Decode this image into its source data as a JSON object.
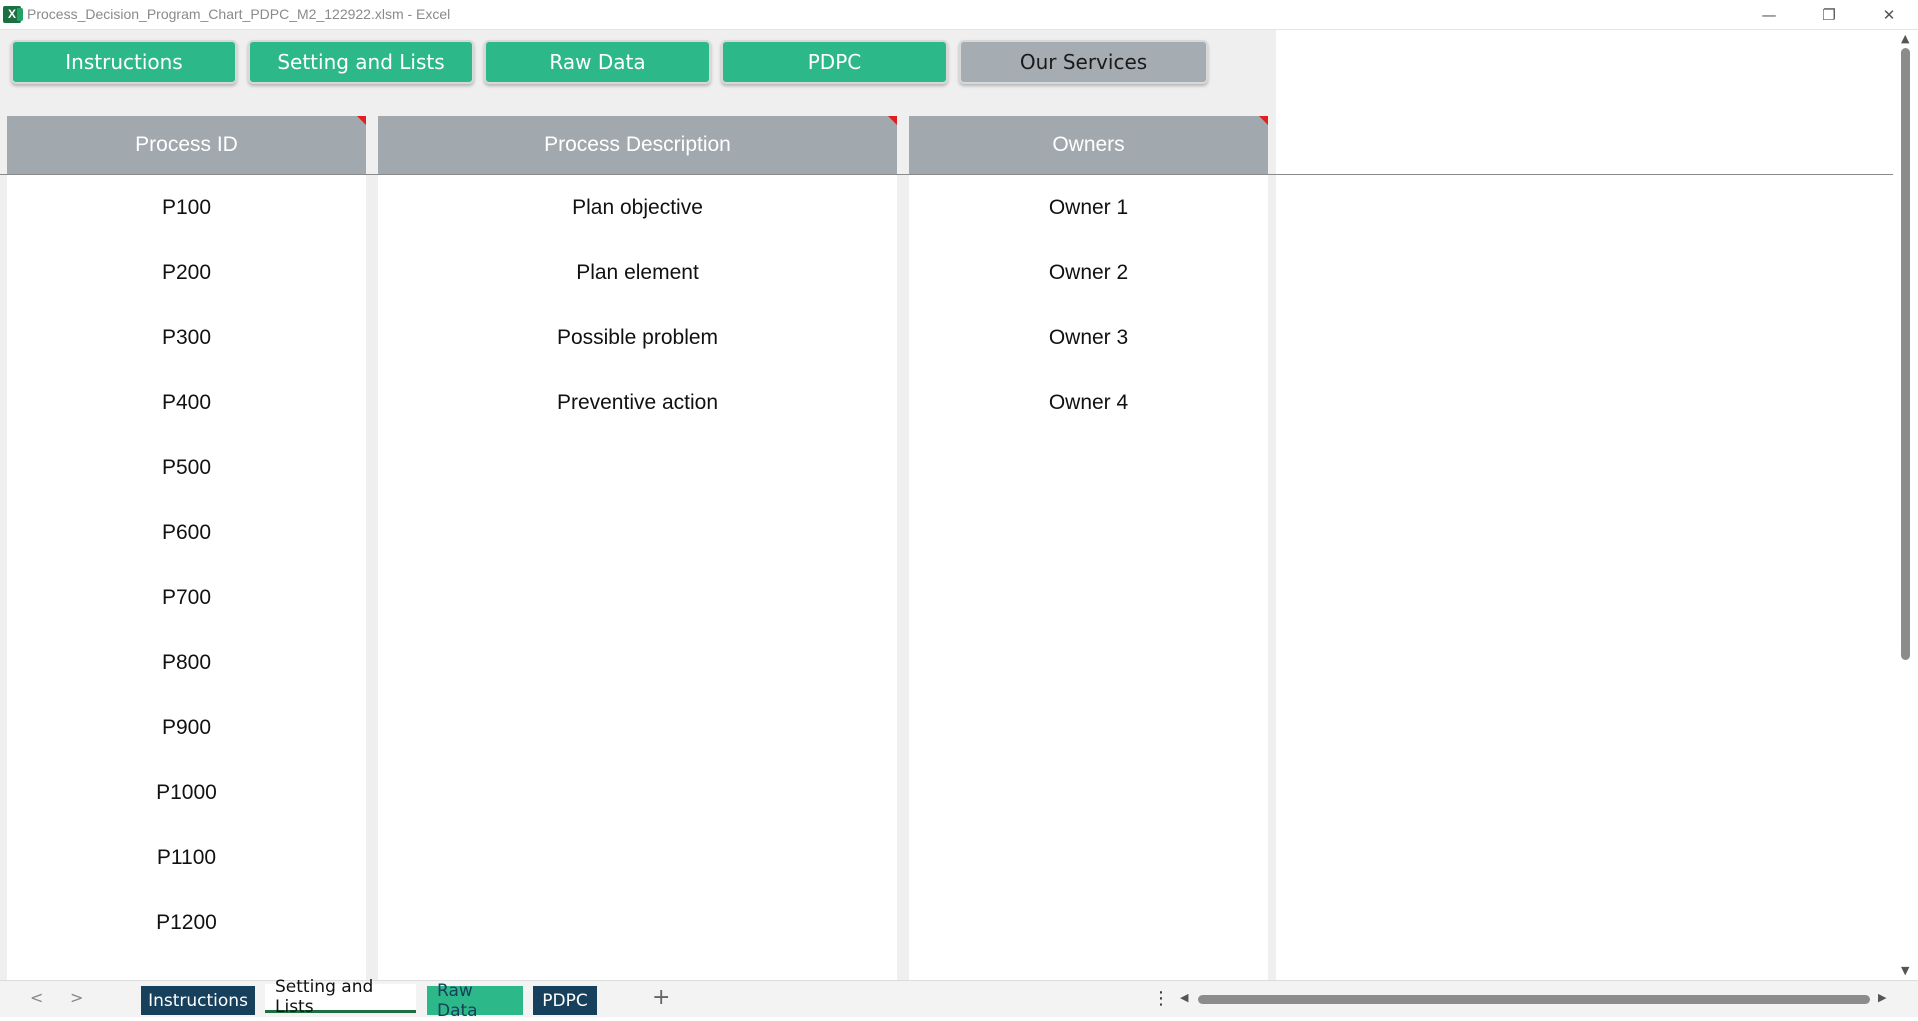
{
  "window": {
    "title": "Process_Decision_Program_Chart_PDPC_M2_122922.xlsm - Excel",
    "app_icon_letter": "X",
    "controls": {
      "minimize": "—",
      "restore": "❐",
      "close": "✕"
    }
  },
  "nav_buttons": [
    {
      "label": "Instructions"
    },
    {
      "label": "Setting and Lists"
    },
    {
      "label": "Raw Data"
    },
    {
      "label": "PDPC"
    },
    {
      "label": "Our Services"
    }
  ],
  "columns": {
    "process_id": {
      "header": "Process ID",
      "values": [
        "P100",
        "P200",
        "P300",
        "P400",
        "P500",
        "P600",
        "P700",
        "P800",
        "P900",
        "P1000",
        "P1100",
        "P1200"
      ]
    },
    "process_description": {
      "header": "Process Description",
      "values": [
        "Plan objective",
        "Plan element",
        "Possible problem",
        "Preventive action"
      ]
    },
    "owners": {
      "header": "Owners",
      "values": [
        "Owner 1",
        "Owner 2",
        "Owner 3",
        "Owner 4"
      ]
    }
  },
  "sheet_tabs": [
    {
      "label": "Instructions",
      "style": "dark"
    },
    {
      "label": "Setting and Lists",
      "style": "active"
    },
    {
      "label": "Raw Data",
      "style": "green"
    },
    {
      "label": "PDPC",
      "style": "dark"
    }
  ],
  "tabbar": {
    "prev": "<",
    "next": ">",
    "add": "+",
    "more": "⋮"
  },
  "colors": {
    "button_green": "#2db88a",
    "button_gray": "#a5adb3",
    "header_gray": "#a1a9af",
    "tab_dark": "#17405c",
    "comment_red": "#e02020"
  }
}
